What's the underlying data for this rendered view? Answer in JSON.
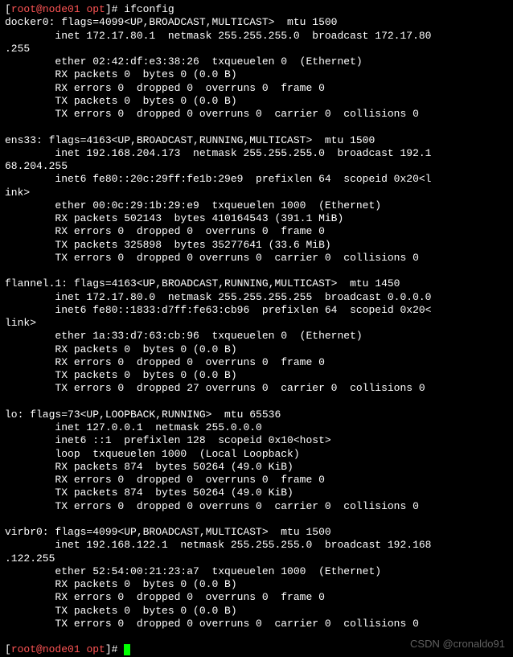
{
  "prompt1": {
    "bracket_open": "[",
    "user_host": "root@node01",
    "path": " opt",
    "bracket_close": "]# ",
    "command": "ifconfig"
  },
  "docker0": {
    "l1": "docker0: flags=4099<UP,BROADCAST,MULTICAST>  mtu 1500",
    "l2": "        inet 172.17.80.1  netmask 255.255.255.0  broadcast 172.17.80",
    "l3": ".255",
    "l4": "        ether 02:42:df:e3:38:26  txqueuelen 0  (Ethernet)",
    "l5": "        RX packets 0  bytes 0 (0.0 B)",
    "l6": "        RX errors 0  dropped 0  overruns 0  frame 0",
    "l7": "        TX packets 0  bytes 0 (0.0 B)",
    "l8": "        TX errors 0  dropped 0 overruns 0  carrier 0  collisions 0"
  },
  "ens33": {
    "l1": "ens33: flags=4163<UP,BROADCAST,RUNNING,MULTICAST>  mtu 1500",
    "l2": "        inet 192.168.204.173  netmask 255.255.255.0  broadcast 192.1",
    "l3": "68.204.255",
    "l4": "        inet6 fe80::20c:29ff:fe1b:29e9  prefixlen 64  scopeid 0x20<l",
    "l5": "ink>",
    "l6": "        ether 00:0c:29:1b:29:e9  txqueuelen 1000  (Ethernet)",
    "l7": "        RX packets 502143  bytes 410164543 (391.1 MiB)",
    "l8": "        RX errors 0  dropped 0  overruns 0  frame 0",
    "l9": "        TX packets 325898  bytes 35277641 (33.6 MiB)",
    "l10": "        TX errors 0  dropped 0 overruns 0  carrier 0  collisions 0"
  },
  "flannel": {
    "l1": "flannel.1: flags=4163<UP,BROADCAST,RUNNING,MULTICAST>  mtu 1450",
    "l2": "        inet 172.17.80.0  netmask 255.255.255.255  broadcast 0.0.0.0",
    "l3": "        inet6 fe80::1833:d7ff:fe63:cb96  prefixlen 64  scopeid 0x20<",
    "l4": "link>",
    "l5": "        ether 1a:33:d7:63:cb:96  txqueuelen 0  (Ethernet)",
    "l6": "        RX packets 0  bytes 0 (0.0 B)",
    "l7": "        RX errors 0  dropped 0  overruns 0  frame 0",
    "l8": "        TX packets 0  bytes 0 (0.0 B)",
    "l9": "        TX errors 0  dropped 27 overruns 0  carrier 0  collisions 0"
  },
  "lo": {
    "l1": "lo: flags=73<UP,LOOPBACK,RUNNING>  mtu 65536",
    "l2": "        inet 127.0.0.1  netmask 255.0.0.0",
    "l3": "        inet6 ::1  prefixlen 128  scopeid 0x10<host>",
    "l4": "        loop  txqueuelen 1000  (Local Loopback)",
    "l5": "        RX packets 874  bytes 50264 (49.0 KiB)",
    "l6": "        RX errors 0  dropped 0  overruns 0  frame 0",
    "l7": "        TX packets 874  bytes 50264 (49.0 KiB)",
    "l8": "        TX errors 0  dropped 0 overruns 0  carrier 0  collisions 0"
  },
  "virbr0": {
    "l1": "virbr0: flags=4099<UP,BROADCAST,MULTICAST>  mtu 1500",
    "l2": "        inet 192.168.122.1  netmask 255.255.255.0  broadcast 192.168",
    "l3": ".122.255",
    "l4": "        ether 52:54:00:21:23:a7  txqueuelen 1000  (Ethernet)",
    "l5": "        RX packets 0  bytes 0 (0.0 B)",
    "l6": "        RX errors 0  dropped 0  overruns 0  frame 0",
    "l7": "        TX packets 0  bytes 0 (0.0 B)",
    "l8": "        TX errors 0  dropped 0 overruns 0  carrier 0  collisions 0"
  },
  "prompt2": {
    "bracket_open": "[",
    "user_host": "root@node01",
    "path": " opt",
    "bracket_close": "]# "
  },
  "watermark": "CSDN @cronaldo91"
}
